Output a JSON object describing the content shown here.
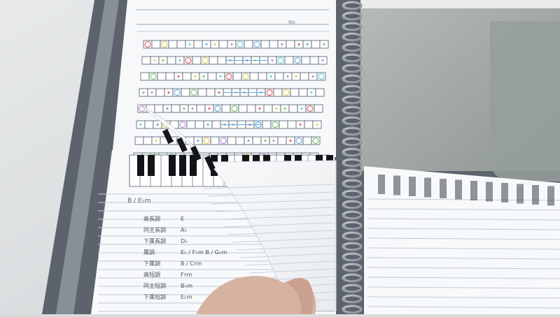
{
  "scene": {
    "subject": "spiral-notebook-with-music-notation-and-piano-keys"
  },
  "notebook": {
    "page_header_mark": "No.",
    "chord_heading": "B / E♭m",
    "chords": [
      {
        "name": "高長調",
        "value": "E"
      },
      {
        "name": "同主長調",
        "value": "A♭"
      },
      {
        "name": "下属長調",
        "value": "D♭"
      },
      {
        "name": "属調",
        "value": "E♭ / F♭m   B / G♭m"
      },
      {
        "name": "下属調",
        "value": "B / C♯m"
      },
      {
        "name": "高短調",
        "value": "F♯m"
      },
      {
        "name": "同主短調",
        "value": "B♭m"
      },
      {
        "name": "下属短調",
        "value": "E♭m"
      }
    ]
  },
  "colors": {
    "binder": "#5f6670",
    "paper": "#f8f9fb",
    "rule": "#b9c3cf",
    "ring": "#b8bcc2",
    "pocket": "#a9b0ac",
    "skin": "#d8b8a8",
    "note_colors": [
      "#e56b6b",
      "#6fb2e8",
      "#e7d15e",
      "#87c776",
      "#c58fe0",
      "#6fd2d6"
    ]
  }
}
